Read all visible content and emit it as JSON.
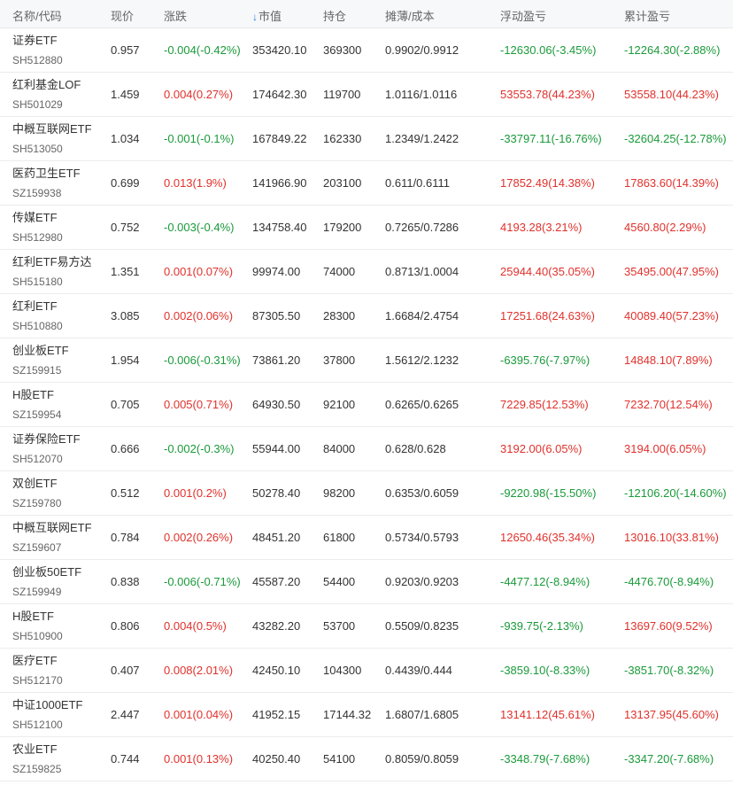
{
  "header": {
    "name": "名称/代码",
    "price": "现价",
    "change": "涨跌",
    "sort_icon": "↓",
    "market_value": "市值",
    "holding": "持仓",
    "cost": "摊薄/成本",
    "float_pl": "浮动盈亏",
    "total_pl": "累计盈亏"
  },
  "colors": {
    "up": "#e0312c",
    "down": "#1a9a3a",
    "accent": "#2a7de1"
  },
  "rows": [
    {
      "name": "证券ETF",
      "code": "SH512880",
      "price": "0.957",
      "change": "-0.004(-0.42%)",
      "change_dir": "down",
      "mv": "353420.10",
      "hold": "369300",
      "cost": "0.9902/0.9912",
      "float": "-12630.06(-3.45%)",
      "float_dir": "down",
      "total": "-12264.30(-2.88%)",
      "total_dir": "down"
    },
    {
      "name": "红利基金LOF",
      "code": "SH501029",
      "price": "1.459",
      "change": "0.004(0.27%)",
      "change_dir": "up",
      "mv": "174642.30",
      "hold": "119700",
      "cost": "1.0116/1.0116",
      "float": "53553.78(44.23%)",
      "float_dir": "up",
      "total": "53558.10(44.23%)",
      "total_dir": "up"
    },
    {
      "name": "中概互联网ETF",
      "code": "SH513050",
      "price": "1.034",
      "change": "-0.001(-0.1%)",
      "change_dir": "down",
      "mv": "167849.22",
      "hold": "162330",
      "cost": "1.2349/1.2422",
      "float": "-33797.11(-16.76%)",
      "float_dir": "down",
      "total": "-32604.25(-12.78%)",
      "total_dir": "down"
    },
    {
      "name": "医药卫生ETF",
      "code": "SZ159938",
      "price": "0.699",
      "change": "0.013(1.9%)",
      "change_dir": "up",
      "mv": "141966.90",
      "hold": "203100",
      "cost": "0.611/0.6111",
      "float": "17852.49(14.38%)",
      "float_dir": "up",
      "total": "17863.60(14.39%)",
      "total_dir": "up"
    },
    {
      "name": "传媒ETF",
      "code": "SH512980",
      "price": "0.752",
      "change": "-0.003(-0.4%)",
      "change_dir": "down",
      "mv": "134758.40",
      "hold": "179200",
      "cost": "0.7265/0.7286",
      "float": "4193.28(3.21%)",
      "float_dir": "up",
      "total": "4560.80(2.29%)",
      "total_dir": "up"
    },
    {
      "name": "红利ETF易方达",
      "code": "SH515180",
      "price": "1.351",
      "change": "0.001(0.07%)",
      "change_dir": "up",
      "mv": "99974.00",
      "hold": "74000",
      "cost": "0.8713/1.0004",
      "float": "25944.40(35.05%)",
      "float_dir": "up",
      "total": "35495.00(47.95%)",
      "total_dir": "up"
    },
    {
      "name": "红利ETF",
      "code": "SH510880",
      "price": "3.085",
      "change": "0.002(0.06%)",
      "change_dir": "up",
      "mv": "87305.50",
      "hold": "28300",
      "cost": "1.6684/2.4754",
      "float": "17251.68(24.63%)",
      "float_dir": "up",
      "total": "40089.40(57.23%)",
      "total_dir": "up"
    },
    {
      "name": "创业板ETF",
      "code": "SZ159915",
      "price": "1.954",
      "change": "-0.006(-0.31%)",
      "change_dir": "down",
      "mv": "73861.20",
      "hold": "37800",
      "cost": "1.5612/2.1232",
      "float": "-6395.76(-7.97%)",
      "float_dir": "down",
      "total": "14848.10(7.89%)",
      "total_dir": "up"
    },
    {
      "name": "H股ETF",
      "code": "SZ159954",
      "price": "0.705",
      "change": "0.005(0.71%)",
      "change_dir": "up",
      "mv": "64930.50",
      "hold": "92100",
      "cost": "0.6265/0.6265",
      "float": "7229.85(12.53%)",
      "float_dir": "up",
      "total": "7232.70(12.54%)",
      "total_dir": "up"
    },
    {
      "name": "证券保险ETF",
      "code": "SH512070",
      "price": "0.666",
      "change": "-0.002(-0.3%)",
      "change_dir": "down",
      "mv": "55944.00",
      "hold": "84000",
      "cost": "0.628/0.628",
      "float": "3192.00(6.05%)",
      "float_dir": "up",
      "total": "3194.00(6.05%)",
      "total_dir": "up"
    },
    {
      "name": "双创ETF",
      "code": "SZ159780",
      "price": "0.512",
      "change": "0.001(0.2%)",
      "change_dir": "up",
      "mv": "50278.40",
      "hold": "98200",
      "cost": "0.6353/0.6059",
      "float": "-9220.98(-15.50%)",
      "float_dir": "down",
      "total": "-12106.20(-14.60%)",
      "total_dir": "down"
    },
    {
      "name": "中概互联网ETF",
      "code": "SZ159607",
      "price": "0.784",
      "change": "0.002(0.26%)",
      "change_dir": "up",
      "mv": "48451.20",
      "hold": "61800",
      "cost": "0.5734/0.5793",
      "float": "12650.46(35.34%)",
      "float_dir": "up",
      "total": "13016.10(33.81%)",
      "total_dir": "up"
    },
    {
      "name": "创业板50ETF",
      "code": "SZ159949",
      "price": "0.838",
      "change": "-0.006(-0.71%)",
      "change_dir": "down",
      "mv": "45587.20",
      "hold": "54400",
      "cost": "0.9203/0.9203",
      "float": "-4477.12(-8.94%)",
      "float_dir": "down",
      "total": "-4476.70(-8.94%)",
      "total_dir": "down"
    },
    {
      "name": "H股ETF",
      "code": "SH510900",
      "price": "0.806",
      "change": "0.004(0.5%)",
      "change_dir": "up",
      "mv": "43282.20",
      "hold": "53700",
      "cost": "0.5509/0.8235",
      "float": "-939.75(-2.13%)",
      "float_dir": "down",
      "total": "13697.60(9.52%)",
      "total_dir": "up"
    },
    {
      "name": "医疗ETF",
      "code": "SH512170",
      "price": "0.407",
      "change": "0.008(2.01%)",
      "change_dir": "up",
      "mv": "42450.10",
      "hold": "104300",
      "cost": "0.4439/0.444",
      "float": "-3859.10(-8.33%)",
      "float_dir": "down",
      "total": "-3851.70(-8.32%)",
      "total_dir": "down"
    },
    {
      "name": "中证1000ETF",
      "code": "SH512100",
      "price": "2.447",
      "change": "0.001(0.04%)",
      "change_dir": "up",
      "mv": "41952.15",
      "hold": "17144.32",
      "cost": "1.6807/1.6805",
      "float": "13141.12(45.61%)",
      "float_dir": "up",
      "total": "13137.95(45.60%)",
      "total_dir": "up"
    },
    {
      "name": "农业ETF",
      "code": "SZ159825",
      "price": "0.744",
      "change": "0.001(0.13%)",
      "change_dir": "up",
      "mv": "40250.40",
      "hold": "54100",
      "cost": "0.8059/0.8059",
      "float": "-3348.79(-7.68%)",
      "float_dir": "down",
      "total": "-3347.20(-7.68%)",
      "total_dir": "down"
    }
  ]
}
